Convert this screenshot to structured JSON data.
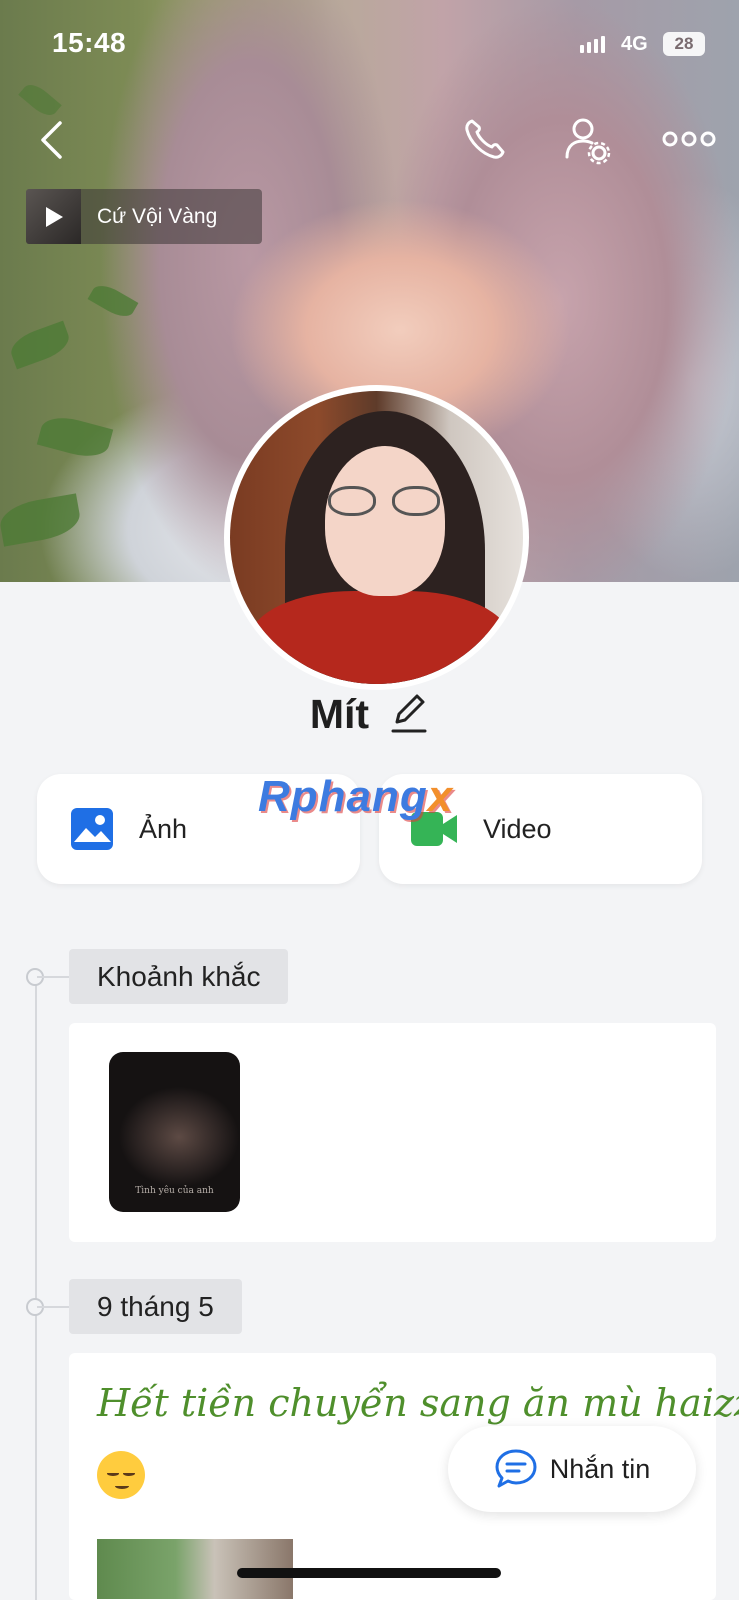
{
  "status_bar": {
    "time": "15:48",
    "network": "4G",
    "battery": "28"
  },
  "header": {
    "back_icon": "chevron-left-icon",
    "call_icon": "phone-icon",
    "profile_settings_icon": "user-gear-icon",
    "more_icon": "more-dots-icon"
  },
  "music": {
    "title": "Cứ Vội Vàng",
    "play_icon": "play-icon"
  },
  "profile": {
    "name": "Mít",
    "edit_icon": "pencil-icon"
  },
  "tiles": [
    {
      "label": "Ảnh",
      "icon": "photo-icon",
      "color": "#1f6fe5"
    },
    {
      "label": "Video",
      "icon": "video-icon",
      "color": "#35b456"
    }
  ],
  "watermark": {
    "text_main": "Rphang",
    "text_accent": "x"
  },
  "timeline": {
    "sections": [
      {
        "label": "Khoảnh khắc"
      },
      {
        "label": "9 tháng 5"
      }
    ],
    "moment_caption": "Tình yêu của anh",
    "post_text": "Hết tiền chuyển sang ăn mù haizzz"
  },
  "message_button": {
    "label": "Nhắn tin",
    "icon": "chat-bubble-icon",
    "color": "#1f6fe5"
  }
}
